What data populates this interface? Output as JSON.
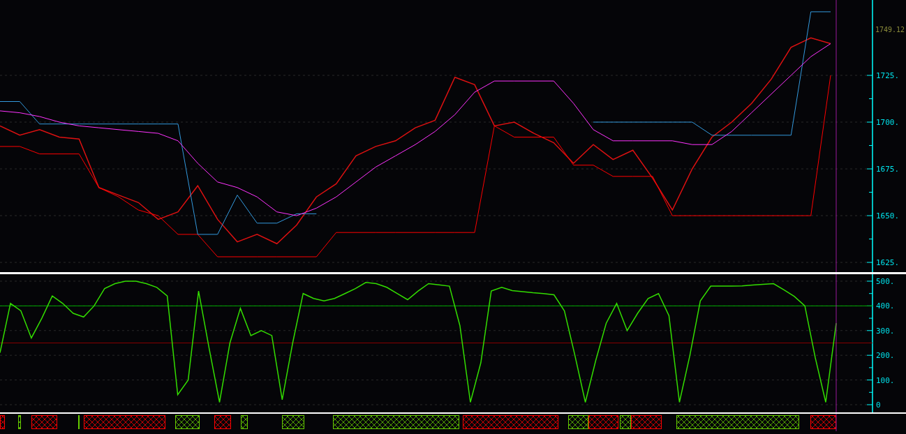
{
  "price_panel": {
    "chart_data": {
      "type": "line",
      "ylim": [
        1619.8,
        1765.3
      ],
      "grid": true,
      "yticks": [
        {
          "value": 1625,
          "label": "1625."
        },
        {
          "value": 1650,
          "label": "1650."
        },
        {
          "value": 1675,
          "label": "1675."
        },
        {
          "value": 1700,
          "label": "1700."
        },
        {
          "value": 1725,
          "label": "1725."
        }
      ],
      "categories": [
        null,
        null,
        null,
        null,
        null,
        null,
        null,
        null,
        null,
        null,
        null,
        null,
        null,
        null,
        null,
        null,
        null,
        null,
        null,
        null,
        null,
        null,
        null,
        null,
        null,
        null,
        null,
        null,
        null,
        null,
        null,
        null,
        null,
        null,
        null,
        null,
        null,
        null,
        null,
        null,
        null,
        null,
        null
      ],
      "series": [
        {
          "color": "#dd1111",
          "values": [
            1698,
            1693,
            1696,
            1692,
            1691,
            1665,
            1661,
            1657,
            1648,
            1652,
            1666,
            1648,
            1636,
            1640,
            1635,
            1645,
            1660,
            1667,
            1682,
            1687,
            1690,
            1697,
            1701,
            1724,
            1720,
            1698,
            1700,
            1694,
            1689,
            1678,
            1688,
            1680,
            1685,
            1670,
            1653,
            1675,
            1692,
            1700,
            1710,
            1723,
            1740,
            1745,
            1742
          ]
        },
        {
          "color": "#ff0000",
          "values": [
            1687,
            1687,
            1683,
            1683,
            1683,
            1665,
            1660,
            1653,
            1650,
            1640,
            1640,
            1628,
            1628,
            1628,
            1628,
            1628,
            1628,
            1641,
            1641,
            1641,
            1641,
            1641,
            1641,
            1641,
            1641,
            1698,
            1692,
            1692,
            1692,
            1677,
            1677,
            1671,
            1671,
            1671,
            1650,
            1650,
            1650,
            1650,
            1650,
            1650,
            1650,
            1650,
            1725
          ]
        },
        {
          "color": "#3399dd",
          "values": [
            1711,
            1711,
            1699,
            1699,
            1699,
            1699,
            1699,
            1699,
            1699,
            1699,
            1640,
            1640,
            1661,
            1646,
            1646,
            1651,
            1651,
            null,
            null,
            null,
            null,
            null,
            null,
            null,
            null,
            null,
            null,
            null,
            null,
            null,
            1700,
            1700,
            1700,
            1700,
            1700,
            1700,
            1693,
            1693,
            1693,
            1693,
            1693,
            1759,
            1759
          ]
        },
        {
          "color": "#ff33ff",
          "values": [
            1706,
            1705,
            1703,
            1700,
            1698,
            1697,
            1696,
            1695,
            1694,
            1690,
            1678,
            1668,
            1665,
            1660,
            1652,
            1650,
            1654,
            1660,
            1668,
            1676,
            1682,
            1688,
            1695,
            1704,
            1716,
            1722,
            1722,
            1722,
            1722,
            1710,
            1696,
            1690,
            1690,
            1690,
            1690,
            1688,
            1688,
            1695,
            1705,
            1715,
            1725,
            1735,
            1742
          ]
        }
      ],
      "annotations": [
        "1749.12"
      ]
    }
  },
  "oscillator_panel": {
    "chart_data": {
      "type": "line",
      "ylim": [
        -31.1,
        528.2
      ],
      "grid": true,
      "yticks": [
        {
          "value": 0,
          "label": "0"
        },
        {
          "value": 100,
          "label": "100."
        },
        {
          "value": 200,
          "label": "200."
        },
        {
          "value": 300,
          "label": "300."
        },
        {
          "value": 400,
          "label": "400."
        },
        {
          "value": 500,
          "label": "500."
        }
      ],
      "categories": [
        null,
        null,
        null,
        null,
        null,
        null,
        null,
        null,
        null,
        null,
        null,
        null,
        null,
        null,
        null,
        null,
        null,
        null,
        null,
        null,
        null,
        null,
        null,
        null,
        null,
        null,
        null,
        null,
        null,
        null,
        null,
        null,
        null,
        null,
        null,
        null,
        null,
        null,
        null,
        null,
        null,
        null,
        null,
        null,
        null,
        null,
        null,
        null,
        null,
        null,
        null,
        null,
        null,
        null,
        null,
        null,
        null,
        null,
        null,
        null,
        null,
        null,
        null,
        null,
        null,
        null,
        null,
        null,
        null,
        null,
        null,
        null,
        null,
        null,
        null,
        null,
        null,
        null,
        null,
        null,
        null
      ],
      "series": [
        {
          "color": "#33dd00",
          "values": [
            210,
            410,
            380,
            270,
            350,
            440,
            410,
            370,
            355,
            400,
            470,
            490,
            500,
            500,
            490,
            475,
            440,
            40,
            100,
            460,
            230,
            10,
            250,
            390,
            280,
            300,
            280,
            20,
            250,
            450,
            430,
            420,
            430,
            450,
            470,
            495,
            490,
            475,
            450,
            425,
            460,
            490,
            485,
            480,
            320,
            10,
            170,
            460,
            475,
            462,
            458,
            453,
            450,
            445,
            380,
            200,
            10,
            180,
            330,
            410,
            300,
            370,
            430,
            450,
            360,
            10,
            200,
            420,
            480,
            480,
            480,
            481,
            484,
            487,
            490,
            465,
            438,
            400,
            190,
            10,
            330
          ]
        }
      ],
      "ref_lines": [
        {
          "axis": "y",
          "value": 400,
          "color": "#00aa00"
        },
        {
          "axis": "y",
          "value": 250,
          "color": "#880000"
        }
      ]
    }
  },
  "signal_strip": {
    "blocks": [
      {
        "color": "#ff0000"
      },
      {
        "color": "#66cc00"
      },
      {
        "color": "#ff0000"
      },
      {
        "color": "#66cc00"
      },
      {
        "color": "#ff0000"
      },
      {
        "color": "#66cc00"
      },
      {
        "color": "#ff0000"
      },
      {
        "color": "#66cc00"
      },
      {
        "color": "#66cc00"
      },
      {
        "color": "#66cc00"
      },
      {
        "color": "#ff0000"
      },
      {
        "color": "#66cc00"
      },
      {
        "color": "#ff0000"
      },
      {
        "color": "#66cc00"
      },
      {
        "color": "#ff0000"
      },
      {
        "color": "#66cc00"
      },
      {
        "color": "#ff0000"
      }
    ]
  }
}
